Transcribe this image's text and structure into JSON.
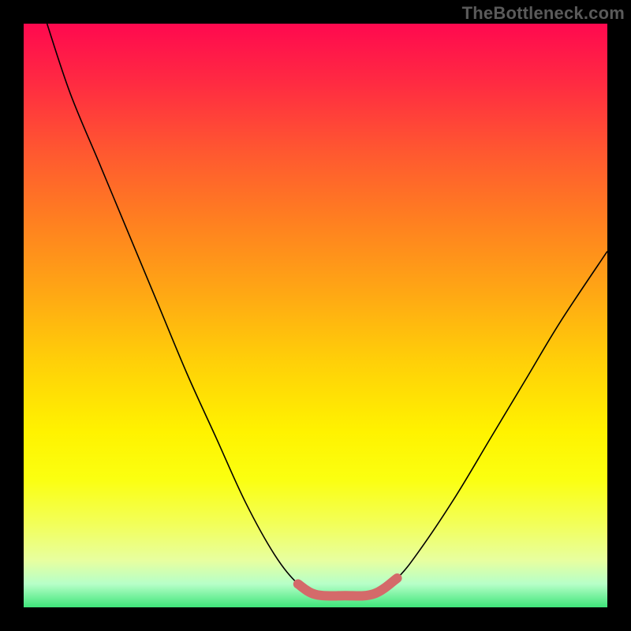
{
  "watermark": "TheBottleneck.com",
  "chart_data": {
    "type": "line",
    "title": "",
    "xlabel": "",
    "ylabel": "",
    "xlim": [
      0,
      100
    ],
    "ylim": [
      0,
      100
    ],
    "grid": false,
    "series": [
      {
        "name": "curve",
        "color": "#000000",
        "width": 1.5,
        "points": [
          {
            "x": 4.0,
            "y": 100.0
          },
          {
            "x": 8.0,
            "y": 88.0
          },
          {
            "x": 13.0,
            "y": 76.0
          },
          {
            "x": 18.0,
            "y": 64.0
          },
          {
            "x": 23.0,
            "y": 52.0
          },
          {
            "x": 28.0,
            "y": 40.0
          },
          {
            "x": 33.0,
            "y": 29.0
          },
          {
            "x": 38.0,
            "y": 18.0
          },
          {
            "x": 43.0,
            "y": 9.0
          },
          {
            "x": 47.0,
            "y": 4.0
          },
          {
            "x": 50.0,
            "y": 2.2
          },
          {
            "x": 55.0,
            "y": 2.0
          },
          {
            "x": 60.0,
            "y": 2.3
          },
          {
            "x": 64.0,
            "y": 5.0
          },
          {
            "x": 68.0,
            "y": 10.0
          },
          {
            "x": 74.0,
            "y": 19.0
          },
          {
            "x": 80.0,
            "y": 29.0
          },
          {
            "x": 86.0,
            "y": 39.0
          },
          {
            "x": 92.0,
            "y": 49.0
          },
          {
            "x": 100.0,
            "y": 61.0
          }
        ]
      },
      {
        "name": "highlight",
        "color": "#d46a6a",
        "width": 10,
        "points": [
          {
            "x": 47.0,
            "y": 4.0
          },
          {
            "x": 50.0,
            "y": 2.2
          },
          {
            "x": 55.0,
            "y": 2.0
          },
          {
            "x": 60.0,
            "y": 2.3
          },
          {
            "x": 64.0,
            "y": 5.0
          }
        ]
      }
    ],
    "background_gradient": {
      "top": "#ff094f",
      "mid_upper": "#ff8020",
      "mid_lower": "#fff300",
      "bottom": "#3fe57a"
    }
  }
}
